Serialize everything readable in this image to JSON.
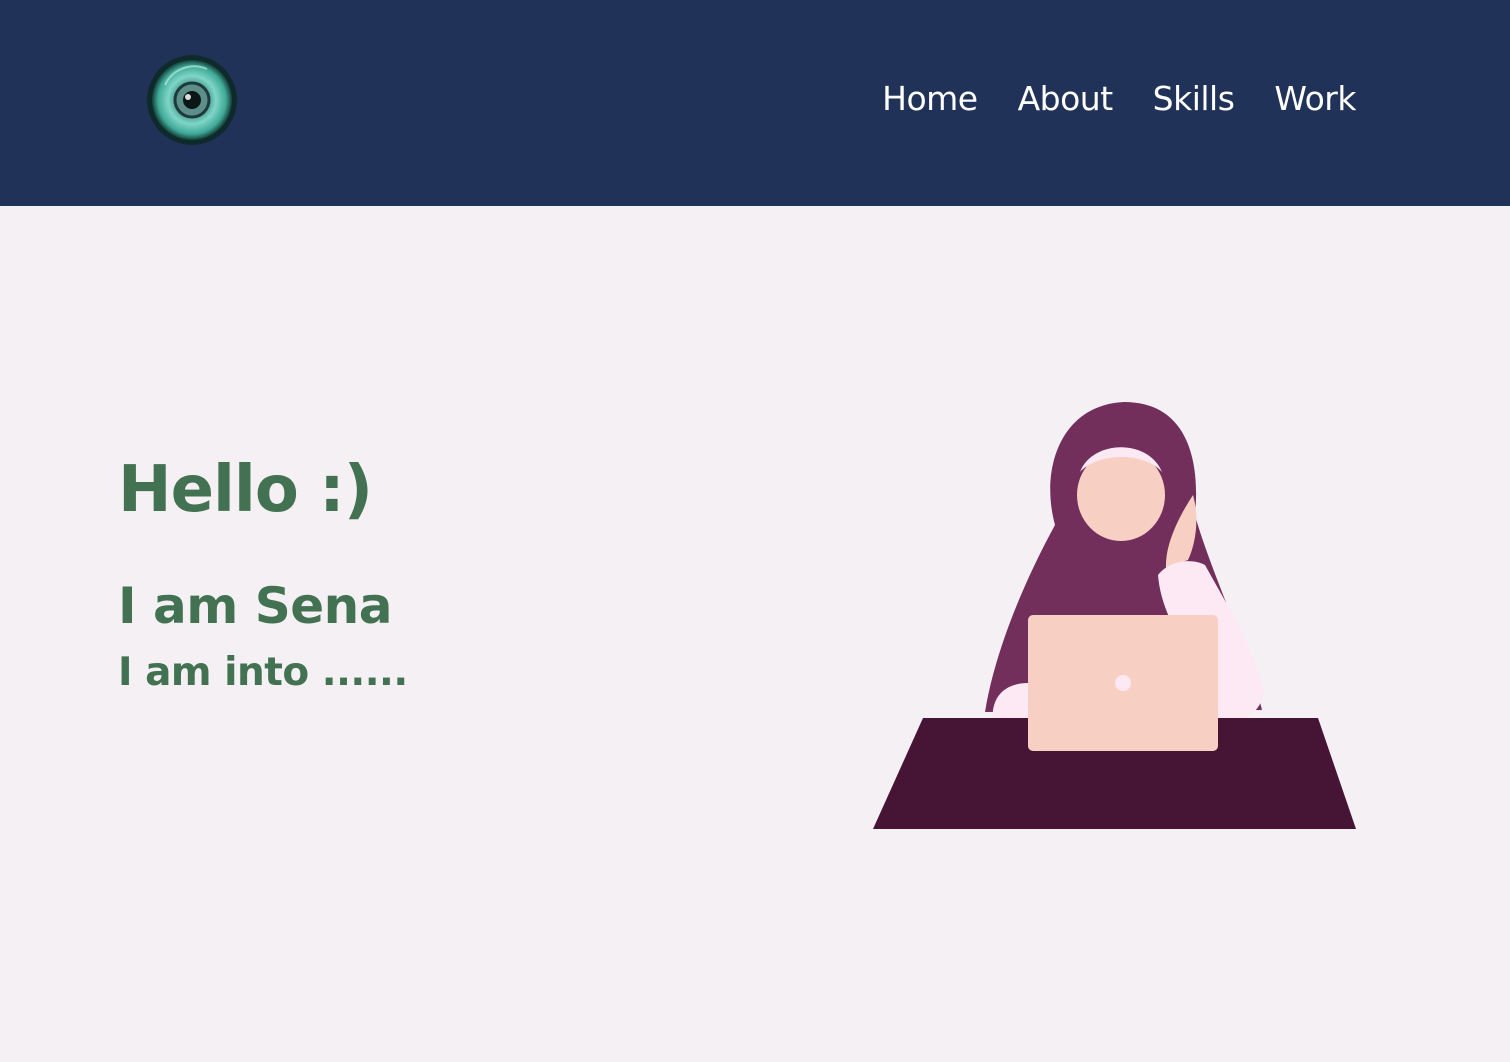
{
  "header": {
    "logo_icon": "eye-icon",
    "nav": [
      {
        "label": "Home"
      },
      {
        "label": "About"
      },
      {
        "label": "Skills"
      },
      {
        "label": "Work"
      }
    ]
  },
  "hero": {
    "greeting": "Hello :)",
    "name_line": "I am Sena",
    "interest_line": "I am into ......",
    "illustration_icon": "woman-with-laptop-illustration"
  },
  "colors": {
    "navbar_bg": "#213259",
    "page_bg": "#f5f0f4",
    "accent_green": "#427252",
    "hijab": "#722f5b",
    "desk": "#461535",
    "skin": "#f7d0c3",
    "sleeve": "#fde9f3"
  }
}
